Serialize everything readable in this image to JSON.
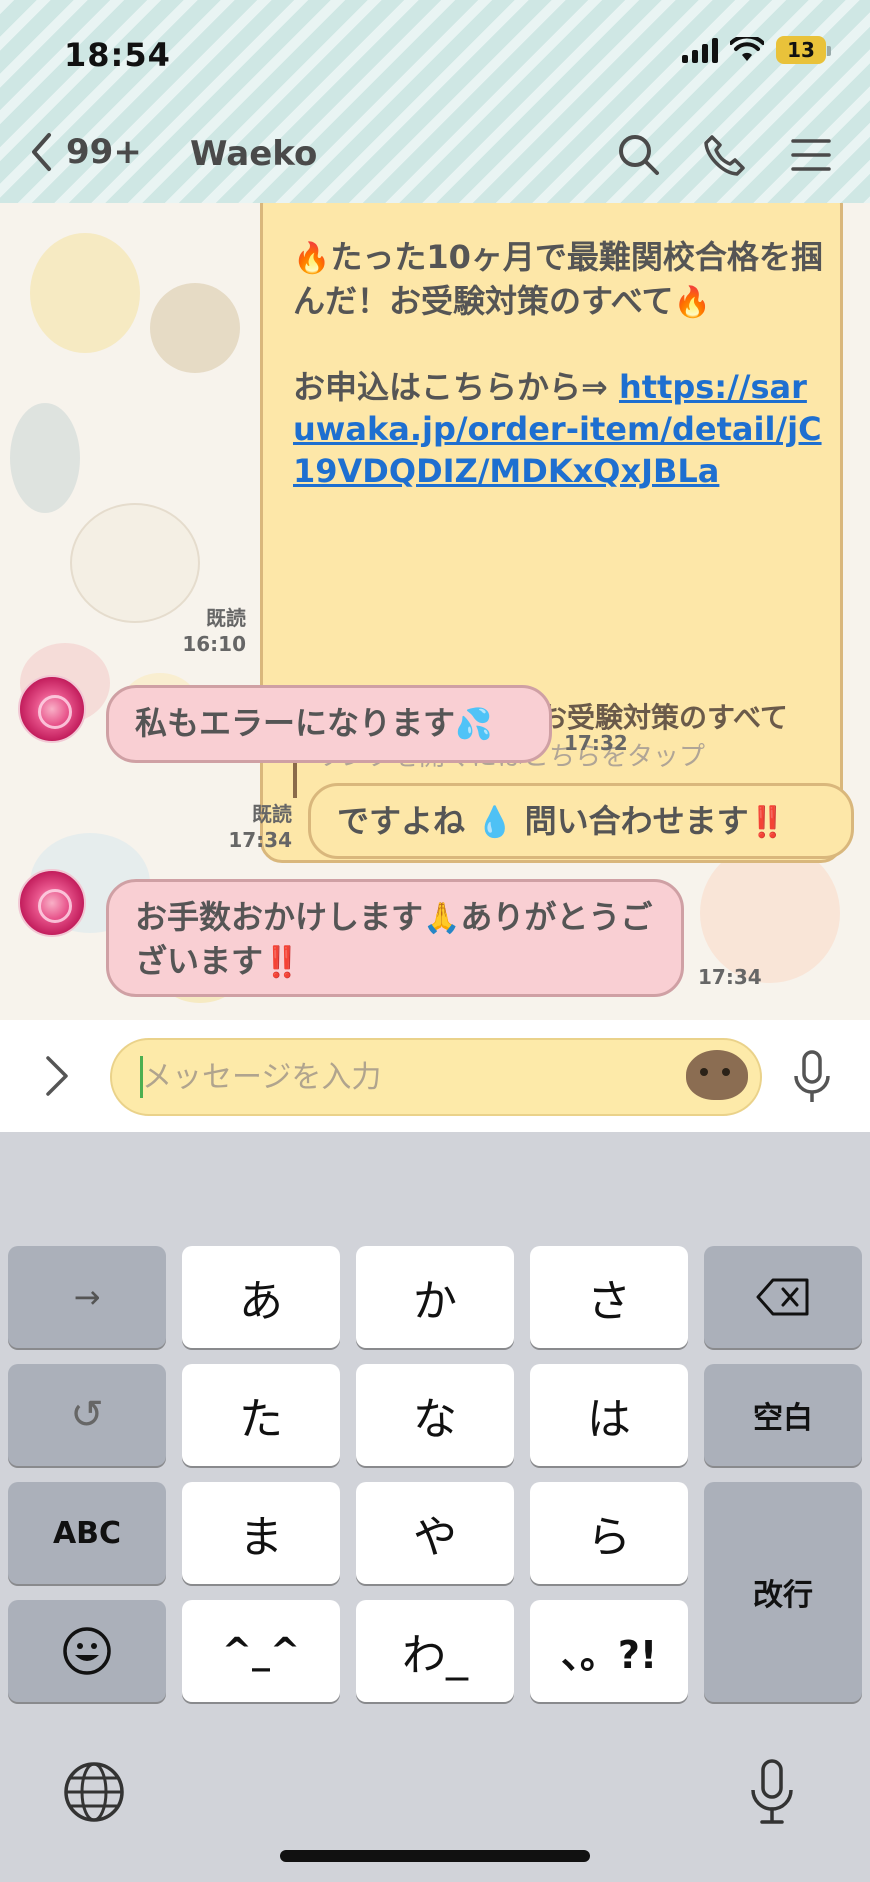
{
  "status_bar": {
    "time": "18:54",
    "battery": "13"
  },
  "nav": {
    "back_label": "99+",
    "title": "Waeko"
  },
  "messages": {
    "big": {
      "line1": "たった10ヶ月で最難関校合格を掴んだ！お受験対策のすべて",
      "apply_prefix": "お申込はこちらから⇒ ",
      "link": "https://saruwaka.jp/order-item/detail/jC19VDQDIZ/MDKxQxJBLa",
      "preview_title": "【動画セミナー】お受験対策のすべて",
      "preview_sub": "リンクを開くにはこちらをタップ",
      "read": "既読",
      "time": "16:10"
    },
    "m1": {
      "text": "私もエラーになります",
      "emoji": "💦",
      "time": "17:32"
    },
    "m2": {
      "text_a": "ですよね",
      "emoji_a": "💧",
      "text_b": "問い合わせます",
      "emoji_b": "‼️",
      "read": "既読",
      "time": "17:34"
    },
    "m3": {
      "text_a": "お手数おかけします",
      "emoji_a": "🙏",
      "text_b": "ありがとうございます",
      "emoji_b": "‼️",
      "time": "17:34"
    }
  },
  "input": {
    "placeholder": "メッセージを入力"
  },
  "keyboard": {
    "arrow": "→",
    "undo": "↺",
    "abc": "ABC",
    "emoji": "☺",
    "k_a": "あ",
    "k_ka": "か",
    "k_sa": "さ",
    "k_ta": "た",
    "k_na": "な",
    "k_ha": "は",
    "k_ma": "ま",
    "k_ya": "や",
    "k_ra": "ら",
    "k_face": "^_^",
    "k_wa": "わ_",
    "k_punct": "、。?!",
    "space": "空白",
    "enter": "改行"
  },
  "colors": {
    "header": "#cfe7e4",
    "bubble_yellow": "#fde7a8",
    "bubble_pink": "#f9cfd3",
    "link": "#1e6fd0",
    "keyboard": "#d1d3d9"
  }
}
